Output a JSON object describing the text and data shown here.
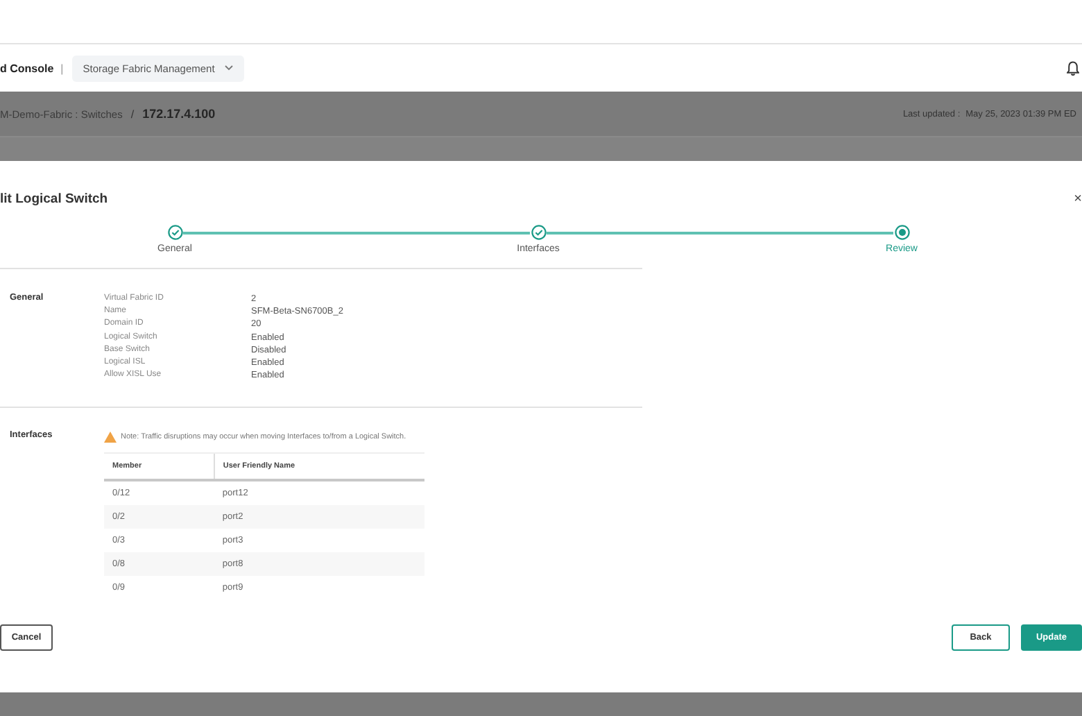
{
  "header": {
    "brand": "d Console",
    "separator": "|",
    "app_menu": "Storage Fabric Management"
  },
  "breadcrumb": {
    "parent": "M-Demo-Fabric : Switches",
    "separator": "/",
    "current": "172.17.4.100",
    "last_updated_label": "Last updated :",
    "last_updated_value": "May 25, 2023 01:39 PM ED"
  },
  "dialog": {
    "title": "lit Logical Switch",
    "close": "×",
    "steps": [
      {
        "label": "General",
        "completed": true,
        "selected": false
      },
      {
        "label": "Interfaces",
        "completed": true,
        "selected": false
      },
      {
        "label": "Review",
        "selected": true
      }
    ],
    "general": {
      "heading": "General",
      "fields": [
        {
          "label": "Virtual Fabric ID",
          "value": "2"
        },
        {
          "label": "Name",
          "value": "SFM-Beta-SN6700B_2"
        },
        {
          "label": "Domain ID",
          "value": "20"
        },
        {
          "label": "Logical Switch",
          "value": "Enabled"
        },
        {
          "label": "Base Switch",
          "value": "Disabled"
        },
        {
          "label": "Logical ISL",
          "value": "Enabled"
        },
        {
          "label": "Allow XISL Use",
          "value": "Enabled"
        }
      ]
    },
    "interfaces": {
      "heading": "Interfaces",
      "note": "Note: Traffic disruptions may occur when moving Interfaces to/from a Logical Switch.",
      "table": {
        "columns": [
          "Member",
          "User Friendly Name"
        ],
        "rows": [
          [
            "0/12",
            "port12"
          ],
          [
            "0/2",
            "port2"
          ],
          [
            "0/3",
            "port3"
          ],
          [
            "0/8",
            "port8"
          ],
          [
            "0/9",
            "port9"
          ]
        ]
      }
    },
    "buttons": [
      {
        "label": "Cancel",
        "kind": "secondary"
      },
      {
        "label": "Back",
        "kind": "outline"
      },
      {
        "label": "Update",
        "kind": "primary"
      }
    ]
  }
}
